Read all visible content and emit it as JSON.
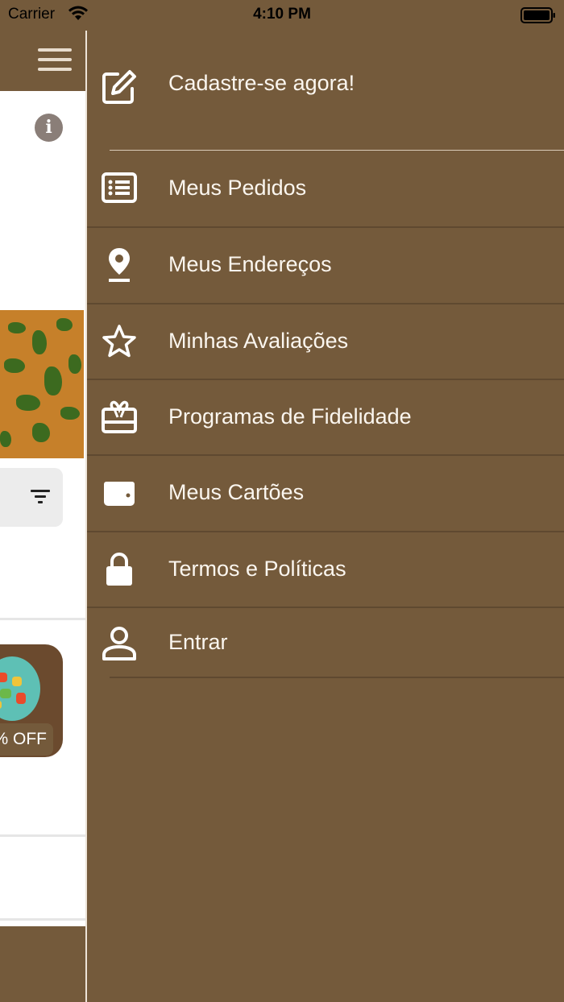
{
  "status_bar": {
    "carrier": "Carrier",
    "time": "4:10 PM"
  },
  "background_screen": {
    "promo_badge": "% OFF"
  },
  "drawer": {
    "register": {
      "label": "Cadastre-se agora!",
      "icon": "edit-icon"
    },
    "items": [
      {
        "label": "Meus Pedidos",
        "icon": "list-icon"
      },
      {
        "label": "Meus Endereços",
        "icon": "location-pin-icon"
      },
      {
        "label": "Minhas Avaliações",
        "icon": "star-icon"
      },
      {
        "label": "Programas de Fidelidade",
        "icon": "gift-card-icon"
      },
      {
        "label": "Meus Cartões",
        "icon": "wallet-icon"
      },
      {
        "label": "Termos e Políticas",
        "icon": "lock-icon"
      },
      {
        "label": "Entrar",
        "icon": "user-icon"
      }
    ]
  },
  "colors": {
    "brand": "#745a3b",
    "text_on_brand": "#ffffff"
  }
}
